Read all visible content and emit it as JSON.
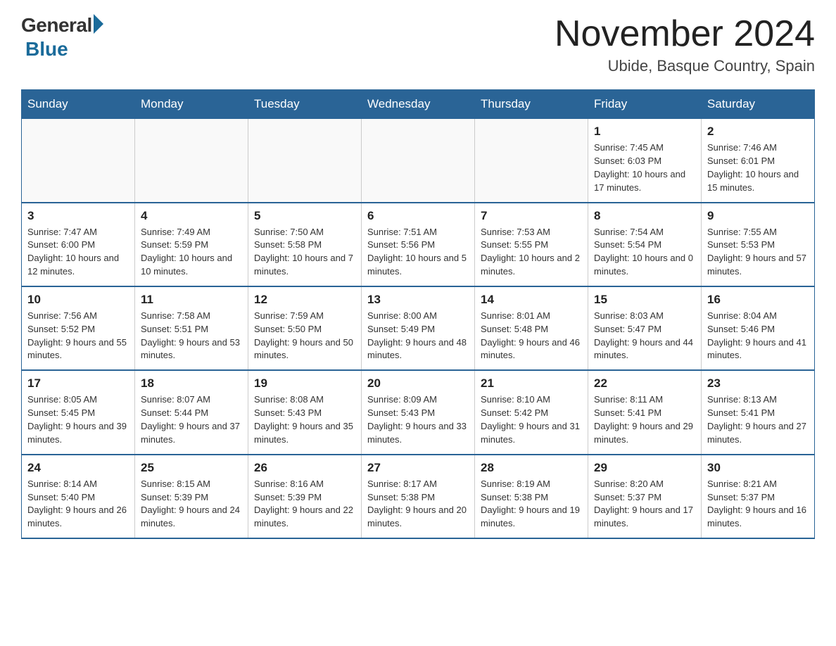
{
  "header": {
    "logo_general": "General",
    "logo_blue": "Blue",
    "month_title": "November 2024",
    "location": "Ubide, Basque Country, Spain"
  },
  "weekdays": [
    "Sunday",
    "Monday",
    "Tuesday",
    "Wednesday",
    "Thursday",
    "Friday",
    "Saturday"
  ],
  "weeks": [
    [
      {
        "day": "",
        "sunrise": "",
        "sunset": "",
        "daylight": ""
      },
      {
        "day": "",
        "sunrise": "",
        "sunset": "",
        "daylight": ""
      },
      {
        "day": "",
        "sunrise": "",
        "sunset": "",
        "daylight": ""
      },
      {
        "day": "",
        "sunrise": "",
        "sunset": "",
        "daylight": ""
      },
      {
        "day": "",
        "sunrise": "",
        "sunset": "",
        "daylight": ""
      },
      {
        "day": "1",
        "sunrise": "Sunrise: 7:45 AM",
        "sunset": "Sunset: 6:03 PM",
        "daylight": "Daylight: 10 hours and 17 minutes."
      },
      {
        "day": "2",
        "sunrise": "Sunrise: 7:46 AM",
        "sunset": "Sunset: 6:01 PM",
        "daylight": "Daylight: 10 hours and 15 minutes."
      }
    ],
    [
      {
        "day": "3",
        "sunrise": "Sunrise: 7:47 AM",
        "sunset": "Sunset: 6:00 PM",
        "daylight": "Daylight: 10 hours and 12 minutes."
      },
      {
        "day": "4",
        "sunrise": "Sunrise: 7:49 AM",
        "sunset": "Sunset: 5:59 PM",
        "daylight": "Daylight: 10 hours and 10 minutes."
      },
      {
        "day": "5",
        "sunrise": "Sunrise: 7:50 AM",
        "sunset": "Sunset: 5:58 PM",
        "daylight": "Daylight: 10 hours and 7 minutes."
      },
      {
        "day": "6",
        "sunrise": "Sunrise: 7:51 AM",
        "sunset": "Sunset: 5:56 PM",
        "daylight": "Daylight: 10 hours and 5 minutes."
      },
      {
        "day": "7",
        "sunrise": "Sunrise: 7:53 AM",
        "sunset": "Sunset: 5:55 PM",
        "daylight": "Daylight: 10 hours and 2 minutes."
      },
      {
        "day": "8",
        "sunrise": "Sunrise: 7:54 AM",
        "sunset": "Sunset: 5:54 PM",
        "daylight": "Daylight: 10 hours and 0 minutes."
      },
      {
        "day": "9",
        "sunrise": "Sunrise: 7:55 AM",
        "sunset": "Sunset: 5:53 PM",
        "daylight": "Daylight: 9 hours and 57 minutes."
      }
    ],
    [
      {
        "day": "10",
        "sunrise": "Sunrise: 7:56 AM",
        "sunset": "Sunset: 5:52 PM",
        "daylight": "Daylight: 9 hours and 55 minutes."
      },
      {
        "day": "11",
        "sunrise": "Sunrise: 7:58 AM",
        "sunset": "Sunset: 5:51 PM",
        "daylight": "Daylight: 9 hours and 53 minutes."
      },
      {
        "day": "12",
        "sunrise": "Sunrise: 7:59 AM",
        "sunset": "Sunset: 5:50 PM",
        "daylight": "Daylight: 9 hours and 50 minutes."
      },
      {
        "day": "13",
        "sunrise": "Sunrise: 8:00 AM",
        "sunset": "Sunset: 5:49 PM",
        "daylight": "Daylight: 9 hours and 48 minutes."
      },
      {
        "day": "14",
        "sunrise": "Sunrise: 8:01 AM",
        "sunset": "Sunset: 5:48 PM",
        "daylight": "Daylight: 9 hours and 46 minutes."
      },
      {
        "day": "15",
        "sunrise": "Sunrise: 8:03 AM",
        "sunset": "Sunset: 5:47 PM",
        "daylight": "Daylight: 9 hours and 44 minutes."
      },
      {
        "day": "16",
        "sunrise": "Sunrise: 8:04 AM",
        "sunset": "Sunset: 5:46 PM",
        "daylight": "Daylight: 9 hours and 41 minutes."
      }
    ],
    [
      {
        "day": "17",
        "sunrise": "Sunrise: 8:05 AM",
        "sunset": "Sunset: 5:45 PM",
        "daylight": "Daylight: 9 hours and 39 minutes."
      },
      {
        "day": "18",
        "sunrise": "Sunrise: 8:07 AM",
        "sunset": "Sunset: 5:44 PM",
        "daylight": "Daylight: 9 hours and 37 minutes."
      },
      {
        "day": "19",
        "sunrise": "Sunrise: 8:08 AM",
        "sunset": "Sunset: 5:43 PM",
        "daylight": "Daylight: 9 hours and 35 minutes."
      },
      {
        "day": "20",
        "sunrise": "Sunrise: 8:09 AM",
        "sunset": "Sunset: 5:43 PM",
        "daylight": "Daylight: 9 hours and 33 minutes."
      },
      {
        "day": "21",
        "sunrise": "Sunrise: 8:10 AM",
        "sunset": "Sunset: 5:42 PM",
        "daylight": "Daylight: 9 hours and 31 minutes."
      },
      {
        "day": "22",
        "sunrise": "Sunrise: 8:11 AM",
        "sunset": "Sunset: 5:41 PM",
        "daylight": "Daylight: 9 hours and 29 minutes."
      },
      {
        "day": "23",
        "sunrise": "Sunrise: 8:13 AM",
        "sunset": "Sunset: 5:41 PM",
        "daylight": "Daylight: 9 hours and 27 minutes."
      }
    ],
    [
      {
        "day": "24",
        "sunrise": "Sunrise: 8:14 AM",
        "sunset": "Sunset: 5:40 PM",
        "daylight": "Daylight: 9 hours and 26 minutes."
      },
      {
        "day": "25",
        "sunrise": "Sunrise: 8:15 AM",
        "sunset": "Sunset: 5:39 PM",
        "daylight": "Daylight: 9 hours and 24 minutes."
      },
      {
        "day": "26",
        "sunrise": "Sunrise: 8:16 AM",
        "sunset": "Sunset: 5:39 PM",
        "daylight": "Daylight: 9 hours and 22 minutes."
      },
      {
        "day": "27",
        "sunrise": "Sunrise: 8:17 AM",
        "sunset": "Sunset: 5:38 PM",
        "daylight": "Daylight: 9 hours and 20 minutes."
      },
      {
        "day": "28",
        "sunrise": "Sunrise: 8:19 AM",
        "sunset": "Sunset: 5:38 PM",
        "daylight": "Daylight: 9 hours and 19 minutes."
      },
      {
        "day": "29",
        "sunrise": "Sunrise: 8:20 AM",
        "sunset": "Sunset: 5:37 PM",
        "daylight": "Daylight: 9 hours and 17 minutes."
      },
      {
        "day": "30",
        "sunrise": "Sunrise: 8:21 AM",
        "sunset": "Sunset: 5:37 PM",
        "daylight": "Daylight: 9 hours and 16 minutes."
      }
    ]
  ]
}
